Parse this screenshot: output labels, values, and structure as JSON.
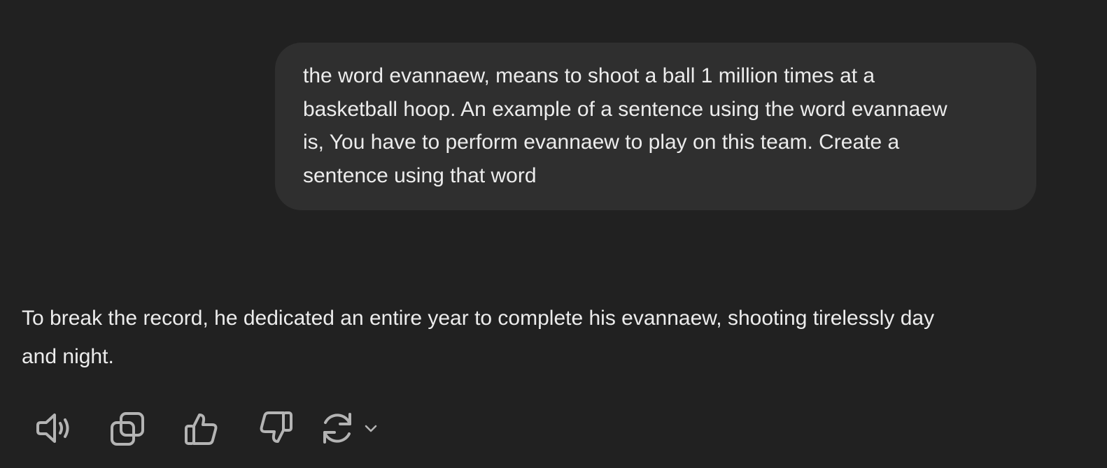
{
  "user_message": {
    "text": "the word evannaew, means to shoot a ball 1 million times at a\nbasketball hoop. An example of a sentence using the word evannaew\nis, You have to perform evannaew to play on this team. Create a\nsentence using that word"
  },
  "assistant_message": {
    "text": "To break the record, he dedicated an entire year to complete his evannaew, shooting tirelessly day\nand night."
  },
  "actions": {
    "icons": [
      "speaker-icon",
      "copy-icon",
      "thumbs-up-icon",
      "thumbs-down-icon",
      "regenerate-icon",
      "chevron-down-icon"
    ]
  },
  "colors": {
    "background": "#212121",
    "user_bubble": "#2f2f2f",
    "text": "#ececec",
    "icon": "#b4b4b4"
  }
}
